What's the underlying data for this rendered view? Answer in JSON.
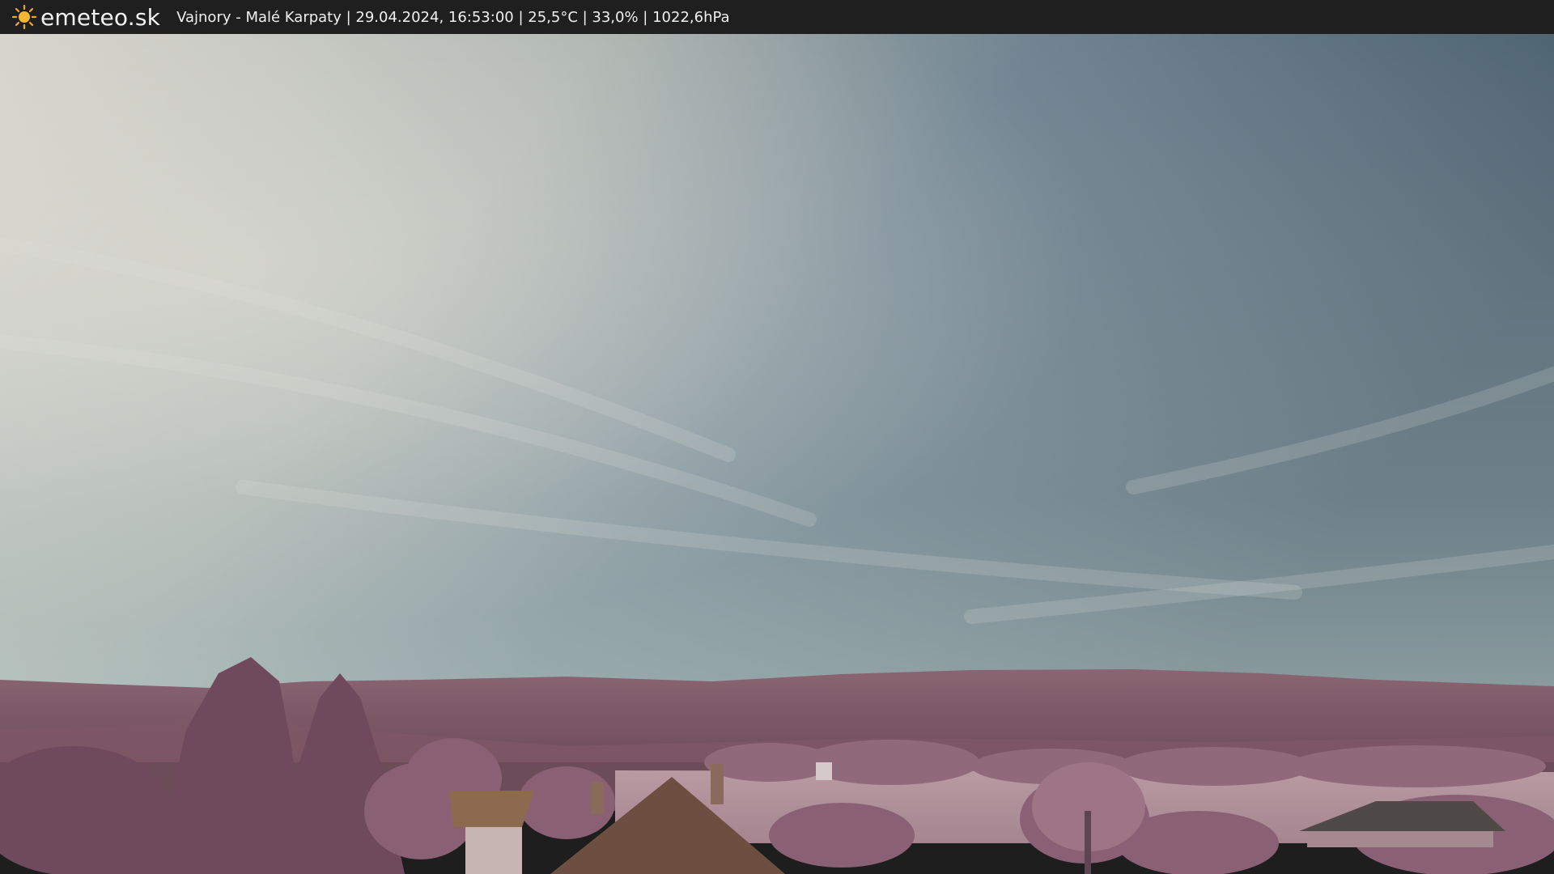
{
  "header": {
    "brand": "emeteo.sk",
    "logo_icon": "sun-icon",
    "logo_color": "#f5a623",
    "station_info": "Vajnory - Malé Karpaty | 29.04.2024, 16:53:00 | 25,5°C | 33,0% | 1022,6hPa"
  },
  "scene": {
    "description_icon": "webcam-image",
    "sky_colors": [
      "#cfcfc6",
      "#8fa0a4",
      "#4e6472"
    ],
    "vegetation_color": "#8a5f73"
  }
}
